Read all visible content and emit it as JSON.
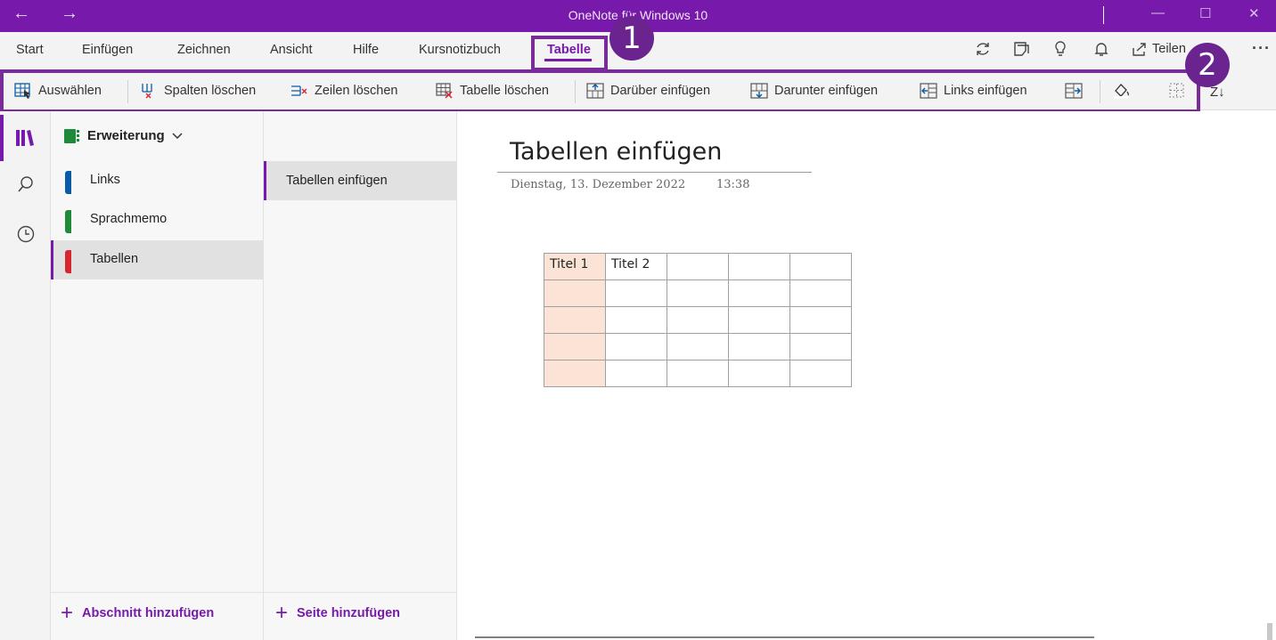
{
  "window": {
    "title": "OneNote für Windows 10",
    "back_glyph": "←",
    "forward_glyph": "→",
    "minimize_glyph": "—",
    "maximize_glyph": "☐",
    "close_glyph": "✕"
  },
  "tabs": [
    "Start",
    "Einfügen",
    "Zeichnen",
    "Ansicht",
    "Hilfe",
    "Kursnotizbuch",
    "Tabelle"
  ],
  "active_tab": "Tabelle",
  "callouts": [
    "1",
    "2"
  ],
  "top_right": {
    "share_label": "Teilen",
    "more_glyph": "···",
    "icons": [
      "sync-icon",
      "page-view-icon",
      "lightbulb-icon",
      "bell-icon",
      "share-icon",
      "more-icon"
    ]
  },
  "ribbon": {
    "select": "Auswählen",
    "delete_columns": "Spalten löschen",
    "delete_rows": "Zeilen löschen",
    "delete_table": "Tabelle löschen",
    "insert_above": "Darüber einfügen",
    "insert_below": "Darunter einfügen",
    "insert_left": "Links einfügen",
    "sort_glyph": "Z↓"
  },
  "notebook": {
    "name": "Erweiterung",
    "color": "#1f8b3a",
    "sections": [
      {
        "label": "Links",
        "color": "#0b5aa8"
      },
      {
        "label": "Sprachmemo",
        "color": "#1f8b3a"
      },
      {
        "label": "Tabellen",
        "color": "#d8262e"
      }
    ],
    "active_section": "Tabellen",
    "add_section": "Abschnitt hinzufügen"
  },
  "pages": {
    "items": [
      "Tabellen einfügen"
    ],
    "add_page": "Seite hinzufügen"
  },
  "page": {
    "title": "Tabellen einfügen",
    "date": "Dienstag, 13. Dezember 2022",
    "time": "13:38",
    "table": {
      "rows": [
        [
          "Titel 1",
          "Titel 2",
          "",
          "",
          ""
        ],
        [
          "",
          "",
          "",
          "",
          ""
        ],
        [
          "",
          "",
          "",
          "",
          ""
        ],
        [
          "",
          "",
          "",
          "",
          ""
        ],
        [
          "",
          "",
          "",
          "",
          ""
        ]
      ],
      "shaded_column": 0,
      "shade_color": "#fbe4d6"
    }
  },
  "colors": {
    "accent": "#7719aa",
    "callout": "#6b2390"
  }
}
